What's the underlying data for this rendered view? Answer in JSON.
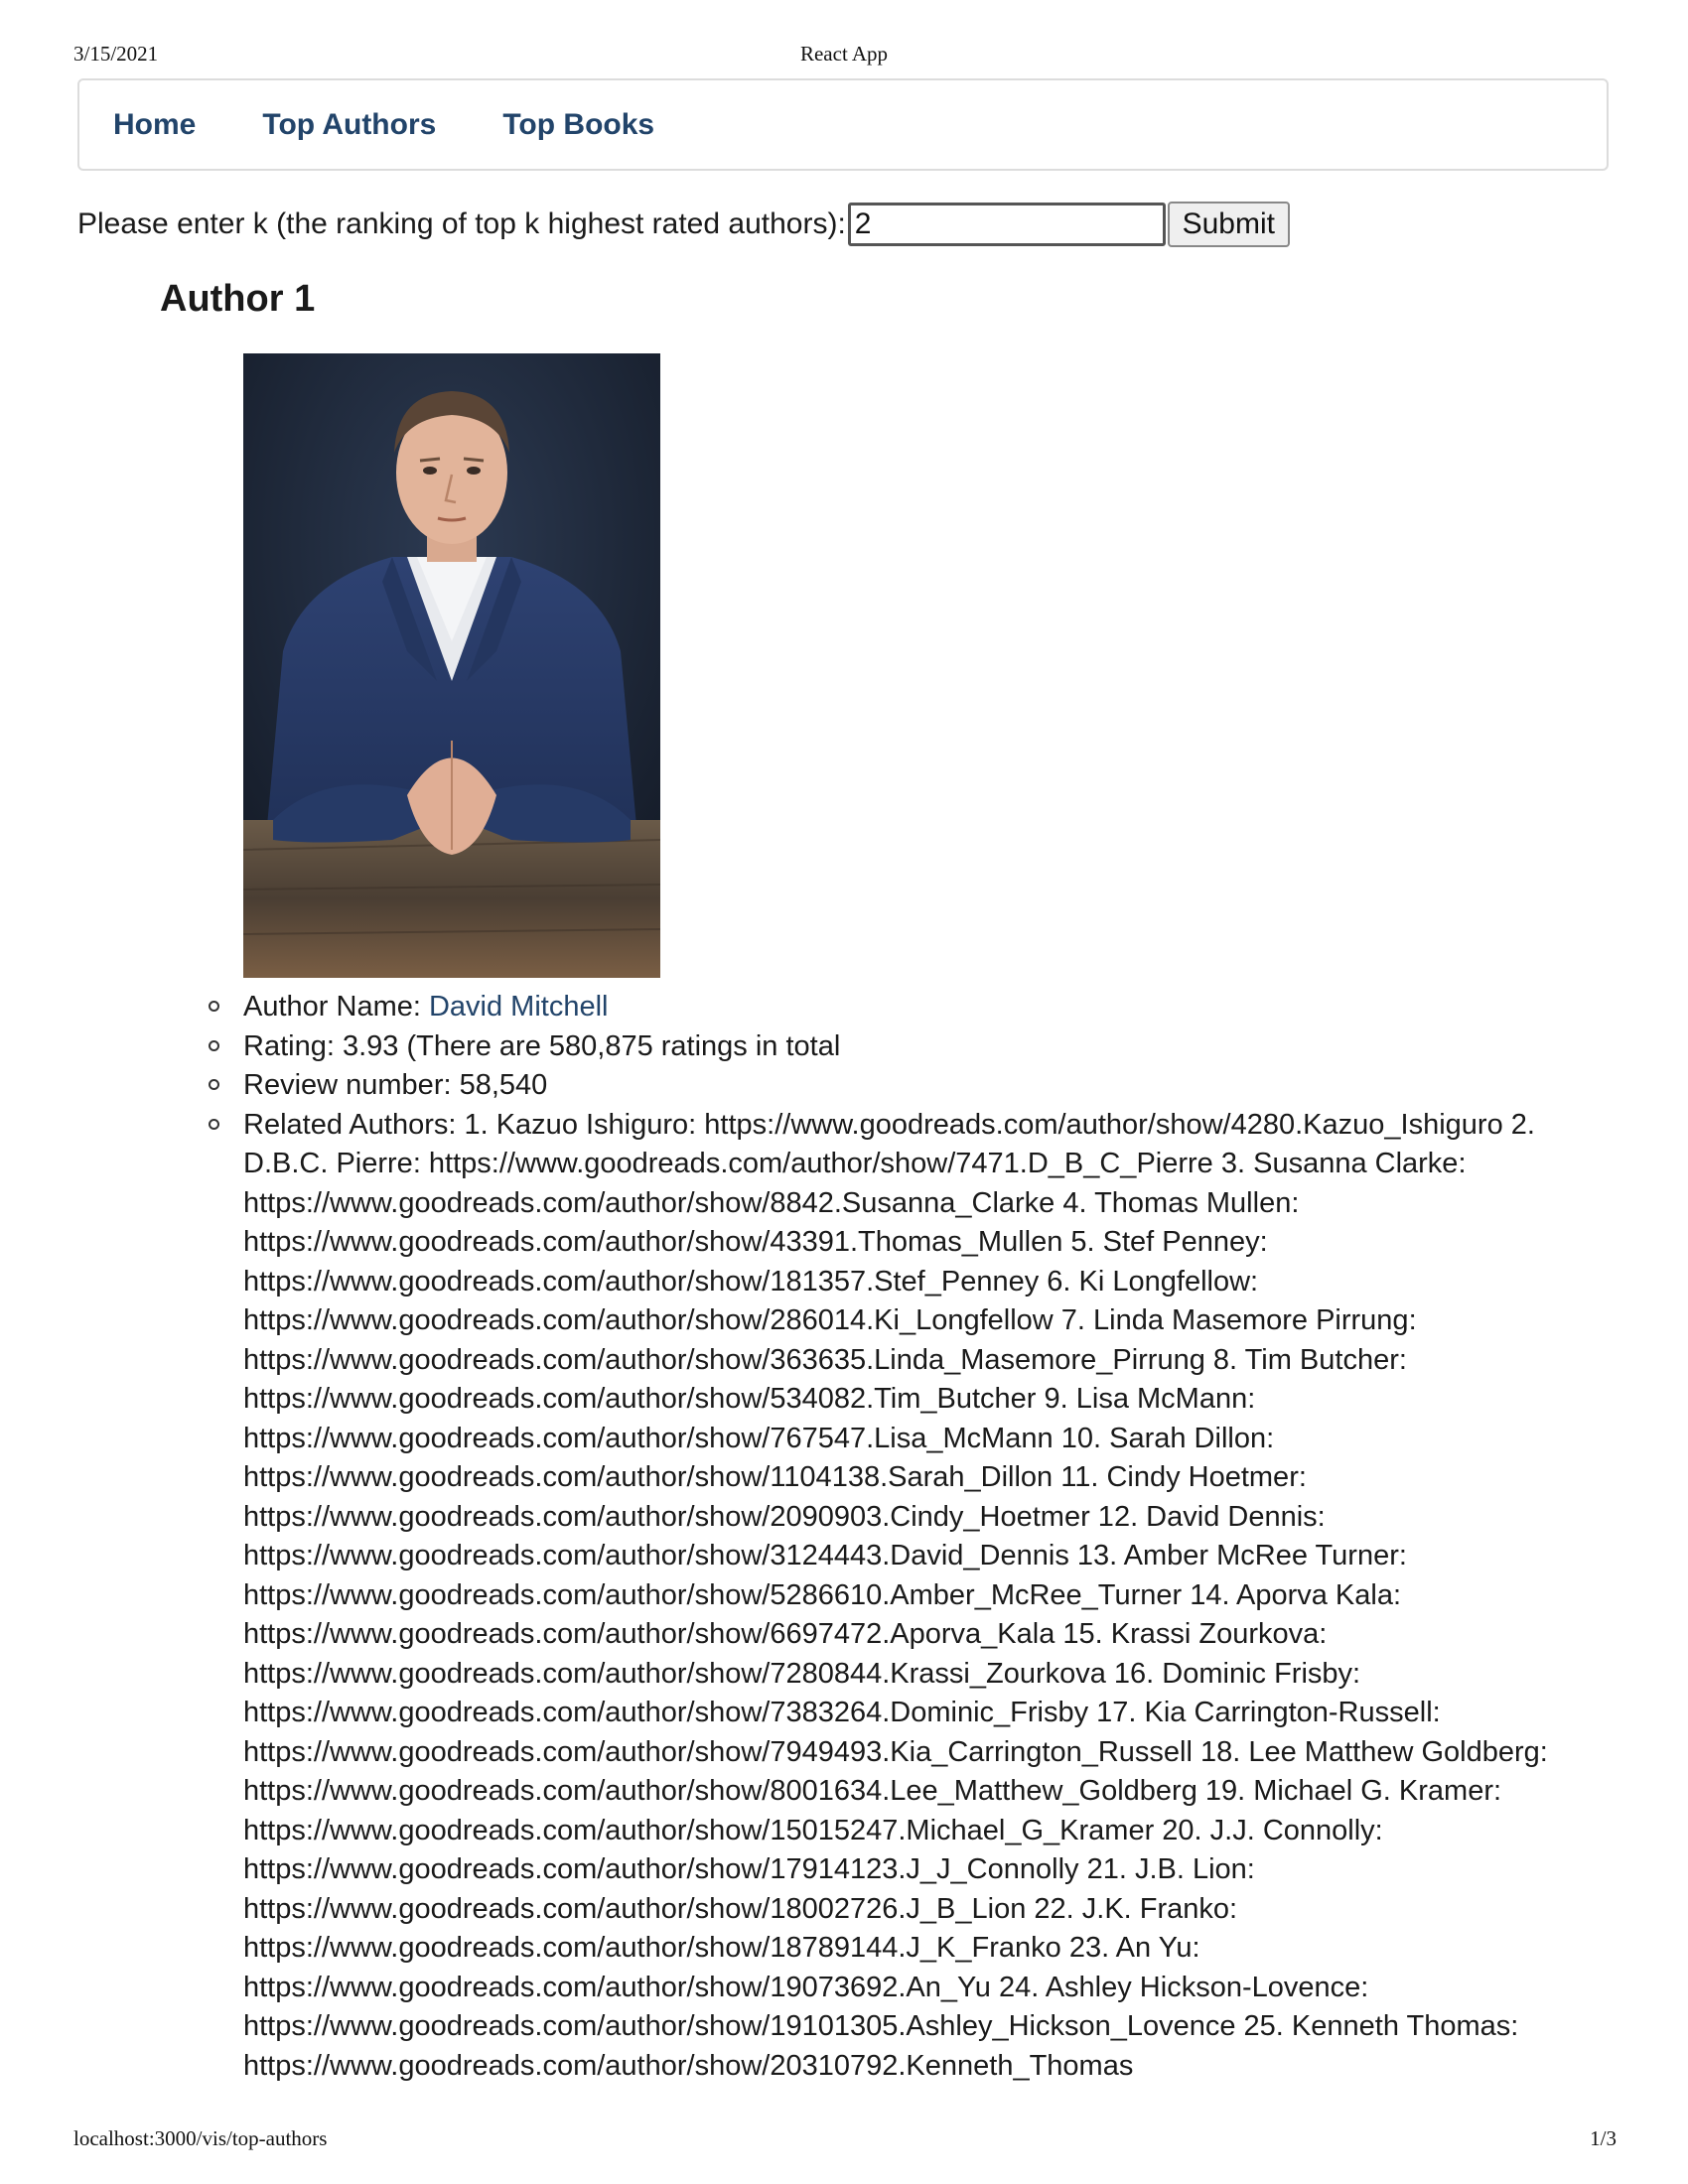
{
  "print": {
    "date": "3/15/2021",
    "page_title": "React App",
    "url": "localhost:3000/vis/top-authors",
    "page_number": "1/3"
  },
  "nav": {
    "items": [
      {
        "label": "Home"
      },
      {
        "label": "Top Authors"
      },
      {
        "label": "Top Books"
      }
    ]
  },
  "query": {
    "label": "Please enter k (the ranking of top k highest rated authors):",
    "value": "2",
    "submit_label": "Submit"
  },
  "author": {
    "heading": "Author 1",
    "name_label": "Author Name: ",
    "name": "David Mitchell",
    "rating_text": "Rating: 3.93 (There are 580,875 ratings in total",
    "review_text": "Review number: 58,540",
    "related_text": "Related Authors: 1. Kazuo Ishiguro: https://www.goodreads.com/author/show/4280.Kazuo_Ishiguro 2. D.B.C. Pierre: https://www.goodreads.com/author/show/7471.D_B_C_Pierre 3. Susanna Clarke: https://www.goodreads.com/author/show/8842.Susanna_Clarke 4. Thomas Mullen: https://www.goodreads.com/author/show/43391.Thomas_Mullen 5. Stef Penney: https://www.goodreads.com/author/show/181357.Stef_Penney 6. Ki Longfellow: https://www.goodreads.com/author/show/286014.Ki_Longfellow 7. Linda Masemore Pirrung: https://www.goodreads.com/author/show/363635.Linda_Masemore_Pirrung 8. Tim Butcher: https://www.goodreads.com/author/show/534082.Tim_Butcher 9. Lisa McMann: https://www.goodreads.com/author/show/767547.Lisa_McMann 10. Sarah Dillon: https://www.goodreads.com/author/show/1104138.Sarah_Dillon 11. Cindy Hoetmer: https://www.goodreads.com/author/show/2090903.Cindy_Hoetmer 12. David Dennis: https://www.goodreads.com/author/show/3124443.David_Dennis 13. Amber McRee Turner: https://www.goodreads.com/author/show/5286610.Amber_McRee_Turner 14. Aporva Kala: https://www.goodreads.com/author/show/6697472.Aporva_Kala 15. Krassi Zourkova: https://www.goodreads.com/author/show/7280844.Krassi_Zourkova 16. Dominic Frisby: https://www.goodreads.com/author/show/7383264.Dominic_Frisby 17. Kia Carrington-Russell: https://www.goodreads.com/author/show/7949493.Kia_Carrington_Russell 18. Lee Matthew Goldberg: https://www.goodreads.com/author/show/8001634.Lee_Matthew_Goldberg 19. Michael G. Kramer: https://www.goodreads.com/author/show/15015247.Michael_G_Kramer 20. J.J. Connolly: https://www.goodreads.com/author/show/17914123.J_J_Connolly 21. J.B. Lion: https://www.goodreads.com/author/show/18002726.J_B_Lion 22. J.K. Franko: https://www.goodreads.com/author/show/18789144.J_K_Franko 23. An Yu: https://www.goodreads.com/author/show/19073692.An_Yu 24. Ashley Hickson-Lovence: https://www.goodreads.com/author/show/19101305.Ashley_Hickson_Lovence 25. Kenneth Thomas: https://www.goodreads.com/author/show/20310792.Kenneth_Thomas"
  }
}
